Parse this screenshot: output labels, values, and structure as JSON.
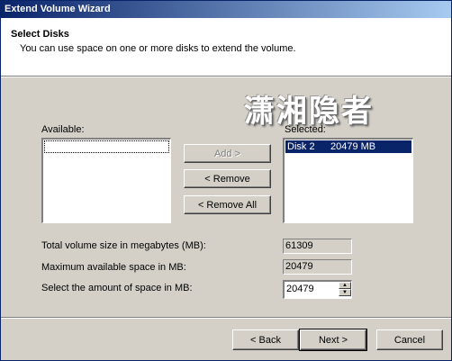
{
  "window": {
    "title": "Extend Volume Wizard"
  },
  "header": {
    "title": "Select Disks",
    "subtitle": "You can use space on one or more disks to extend the volume."
  },
  "watermark": "潇湘隐者",
  "available": {
    "label": "Available:",
    "items": []
  },
  "selected": {
    "label": "Selected:",
    "items": [
      {
        "disk": "Disk 2",
        "size": "20479 MB"
      }
    ]
  },
  "buttons": {
    "add": "Add >",
    "remove": "< Remove",
    "remove_all": "< Remove All",
    "back": "< Back",
    "next": "Next >",
    "cancel": "Cancel"
  },
  "fields": {
    "total_label": "Total volume size in megabytes (MB):",
    "total_value": "61309",
    "max_label": "Maximum available space in MB:",
    "max_value": "20479",
    "amount_label": "Select the amount of space in MB:",
    "amount_value": "20479"
  },
  "icons": {
    "spin_up": "spin-up-arrow-icon",
    "spin_down": "spin-down-arrow-icon"
  }
}
